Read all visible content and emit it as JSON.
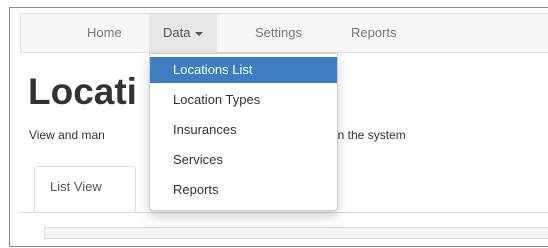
{
  "navbar": {
    "items": [
      {
        "label": "Home"
      },
      {
        "label": "Data"
      },
      {
        "label": "Settings"
      },
      {
        "label": "Reports"
      }
    ]
  },
  "page": {
    "title": "Locati",
    "description": "View and man",
    "description_tail": "in the system"
  },
  "tabs": [
    {
      "label": "List View"
    }
  ],
  "dropdown": {
    "items": [
      {
        "label": "Locations List",
        "active": true
      },
      {
        "label": "Location Types"
      },
      {
        "label": "Insurances"
      },
      {
        "label": "Services"
      },
      {
        "label": "Reports"
      }
    ]
  },
  "colors": {
    "accent": "#3d7ec2",
    "navbar_bg": "#f7f7f7",
    "active_nav_bg": "#e7e7e7"
  }
}
